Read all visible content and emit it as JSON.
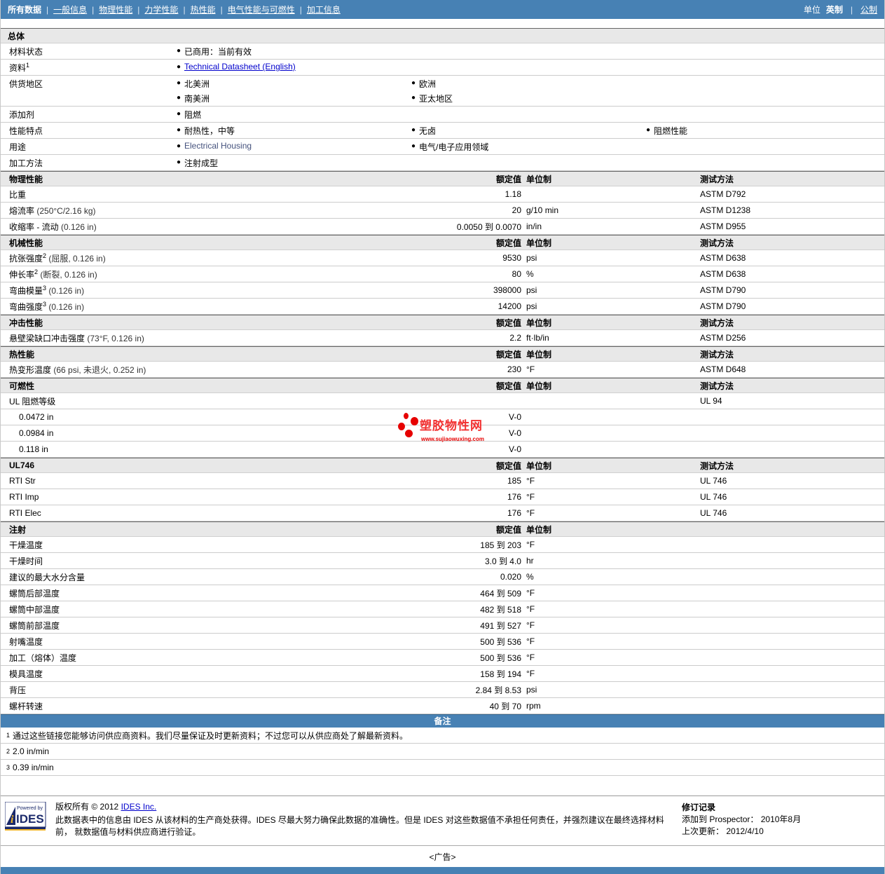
{
  "colors": {
    "nav_blue": "#4781b4",
    "link_blue": "#0000cc",
    "watermark_red": "#e60000",
    "section_gray": "#e8e8e8"
  },
  "nav": {
    "current": "所有数据",
    "links": [
      "一般信息",
      "物理性能",
      "力学性能",
      "热性能",
      "电气性能与可燃性",
      "加工信息"
    ],
    "units_label": "单位",
    "unit_current": "英制",
    "unit_link": "公制"
  },
  "general": {
    "title": "总体",
    "rows": [
      {
        "label": "材料状态",
        "sup": "",
        "cols": [
          [
            {
              "text": "已商用：当前有效"
            }
          ]
        ]
      },
      {
        "label": "资料",
        "sup": "1",
        "cols": [
          [
            {
              "text": "Technical Datasheet (English)",
              "link": true
            }
          ]
        ]
      },
      {
        "label": "供货地区",
        "sup": "",
        "cols": [
          [
            {
              "text": "北美洲"
            },
            {
              "text": "南美洲"
            }
          ],
          [
            {
              "text": "欧洲"
            },
            {
              "text": "亚太地区"
            }
          ]
        ]
      },
      {
        "label": "添加剂",
        "sup": "",
        "cols": [
          [
            {
              "text": "阻燃"
            }
          ]
        ]
      },
      {
        "label": "性能特点",
        "sup": "",
        "cols": [
          [
            {
              "text": "耐热性，中等"
            }
          ],
          [
            {
              "text": "无卤"
            }
          ],
          [
            {
              "text": "阻燃性能"
            }
          ]
        ]
      },
      {
        "label": "用途",
        "sup": "",
        "cols": [
          [
            {
              "text": "Electrical Housing",
              "en": true
            }
          ],
          [
            {
              "text": "电气/电子应用领域"
            }
          ]
        ]
      },
      {
        "label": "加工方法",
        "sup": "",
        "cols": [
          [
            {
              "text": "注射成型"
            }
          ]
        ]
      }
    ]
  },
  "col_headers": {
    "value": "额定值",
    "unit": "单位制",
    "method": "测试方法"
  },
  "property_sections": [
    {
      "title": "物理性能",
      "show_method": true,
      "rows": [
        {
          "label": "比重",
          "sup": "",
          "cond": "",
          "value": "1.18",
          "unit": "",
          "method": "ASTM D792"
        },
        {
          "label": "熔流率",
          "sup": "",
          "cond": "(250°C/2.16 kg)",
          "value": "20",
          "unit": "g/10 min",
          "method": "ASTM D1238"
        },
        {
          "label": "收缩率 - 流动",
          "sup": "",
          "cond": "(0.126 in)",
          "value": "0.0050 到  0.0070",
          "unit": "in/in",
          "method": "ASTM D955"
        }
      ]
    },
    {
      "title": "机械性能",
      "show_method": true,
      "rows": [
        {
          "label": "抗张强度",
          "sup": "2",
          "cond": "(屈服, 0.126 in)",
          "value": "9530",
          "unit": "psi",
          "method": "ASTM D638"
        },
        {
          "label": "伸长率",
          "sup": "2",
          "cond": "(断裂, 0.126 in)",
          "value": "80",
          "unit": "%",
          "method": "ASTM D638"
        },
        {
          "label": "弯曲模量",
          "sup": "3",
          "cond": "(0.126 in)",
          "value": "398000",
          "unit": "psi",
          "method": "ASTM D790"
        },
        {
          "label": "弯曲强度",
          "sup": "3",
          "cond": "(0.126 in)",
          "value": "14200",
          "unit": "psi",
          "method": "ASTM D790"
        }
      ]
    },
    {
      "title": "冲击性能",
      "show_method": true,
      "rows": [
        {
          "label": "悬壁梁缺口冲击强度",
          "sup": "",
          "cond": "(73°F, 0.126 in)",
          "value": "2.2",
          "unit": "ft·lb/in",
          "method": "ASTM D256"
        }
      ]
    },
    {
      "title": "热性能",
      "show_method": true,
      "rows": [
        {
          "label": "热变形温度",
          "sup": "",
          "cond": "(66 psi, 未退火, 0.252 in)",
          "value": "230",
          "unit": "°F",
          "method": "ASTM D648"
        }
      ]
    },
    {
      "title": "可燃性",
      "show_method": true,
      "rows": [
        {
          "label": "UL 阻燃等级",
          "sup": "",
          "cond": "",
          "value": "",
          "unit": "",
          "method": "UL 94"
        },
        {
          "label": "0.0472 in",
          "sup": "",
          "cond": "",
          "indent": true,
          "value": "V-0",
          "unit": "",
          "method": ""
        },
        {
          "label": "0.0984 in",
          "sup": "",
          "cond": "",
          "indent": true,
          "value": "V-0",
          "unit": "",
          "method": ""
        },
        {
          "label": "0.118 in",
          "sup": "",
          "cond": "",
          "indent": true,
          "value": "V-0",
          "unit": "",
          "method": ""
        }
      ]
    },
    {
      "title": "UL746",
      "show_method": true,
      "rows": [
        {
          "label": "RTI Str",
          "sup": "",
          "cond": "",
          "value": "185",
          "unit": "°F",
          "method": "UL 746"
        },
        {
          "label": "RTI Imp",
          "sup": "",
          "cond": "",
          "value": "176",
          "unit": "°F",
          "method": "UL 746"
        },
        {
          "label": "RTI Elec",
          "sup": "",
          "cond": "",
          "value": "176",
          "unit": "°F",
          "method": "UL 746"
        }
      ]
    },
    {
      "title": "注射",
      "show_method": false,
      "rows": [
        {
          "label": "干燥温度",
          "sup": "",
          "cond": "",
          "value": "185 到  203",
          "unit": "°F",
          "method": ""
        },
        {
          "label": "干燥时间",
          "sup": "",
          "cond": "",
          "value": "3.0 到  4.0",
          "unit": "hr",
          "method": ""
        },
        {
          "label": "建议的最大水分含量",
          "sup": "",
          "cond": "",
          "value": "0.020",
          "unit": "%",
          "method": ""
        },
        {
          "label": "螺筒后部温度",
          "sup": "",
          "cond": "",
          "value": "464 到  509",
          "unit": "°F",
          "method": ""
        },
        {
          "label": "螺筒中部温度",
          "sup": "",
          "cond": "",
          "value": "482 到  518",
          "unit": "°F",
          "method": ""
        },
        {
          "label": "螺筒前部温度",
          "sup": "",
          "cond": "",
          "value": "491 到  527",
          "unit": "°F",
          "method": ""
        },
        {
          "label": "射嘴温度",
          "sup": "",
          "cond": "",
          "value": "500 到  536",
          "unit": "°F",
          "method": ""
        },
        {
          "label": "加工（熔体）温度",
          "sup": "",
          "cond": "",
          "value": "500 到  536",
          "unit": "°F",
          "method": ""
        },
        {
          "label": "模具温度",
          "sup": "",
          "cond": "",
          "value": "158 到  194",
          "unit": "°F",
          "method": ""
        },
        {
          "label": "背压",
          "sup": "",
          "cond": "",
          "value": "2.84 到  8.53",
          "unit": "psi",
          "method": ""
        },
        {
          "label": "螺杆转速",
          "sup": "",
          "cond": "",
          "value": "40 到  70",
          "unit": "rpm",
          "method": ""
        }
      ]
    }
  ],
  "notes": {
    "title": "备注",
    "items": [
      {
        "sup": "1",
        "text": "通过这些链接您能够访问供应商资料。我们尽量保证及时更新资料；不过您可以从供应商处了解最新资料。"
      },
      {
        "sup": "2",
        "text": "2.0 in/min"
      },
      {
        "sup": "3",
        "text": "0.39 in/min"
      }
    ]
  },
  "watermark": {
    "brand": "塑胶物性网",
    "url": "www.sujiaowuxing.com"
  },
  "footer": {
    "logo_powered_by": "Powered by",
    "logo_brand": "IDES",
    "copyright_label": "版权所有",
    "copyright_year": "© 2012",
    "company_link": "IDES Inc.",
    "disclaimer": "此数据表中的信息由 IDES 从该材料的生产商处获得。IDES 尽最大努力确保此数据的准确性。但是 IDES 对这些数据值不承担任何责任，并强烈建议在最终选择材料前， 就数据值与材料供应商进行验证。",
    "revision": {
      "title": "修订记录",
      "added_label": "添加到 Prospector：",
      "added_value": "2010年8月",
      "updated_label": "上次更新：",
      "updated_value": "2012/4/10"
    },
    "ad": "<广告>"
  }
}
